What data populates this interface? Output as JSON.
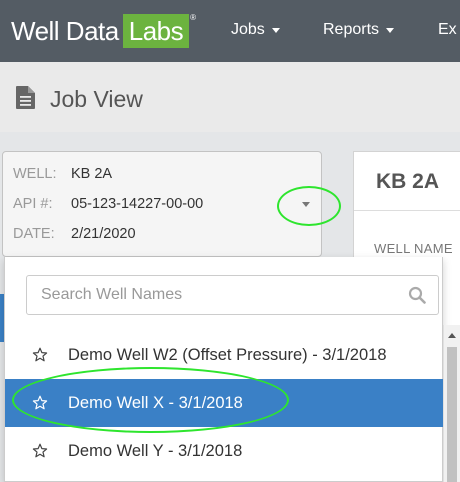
{
  "navbar": {
    "logo_text": "Well Data",
    "logo_box": "Labs",
    "logo_reg": "®",
    "items": [
      {
        "label": "Jobs"
      },
      {
        "label": "Reports"
      },
      {
        "label": "Ex"
      }
    ],
    "background": "#545c64",
    "brand_green": "#6cb33f"
  },
  "page": {
    "title": "Job View",
    "icon": "document-icon"
  },
  "well_info": {
    "well_label": "WELL:",
    "well_value": "KB 2A",
    "api_label": "API #:",
    "api_value": "05-123-14227-00-00",
    "date_label": "DATE:",
    "date_value": "2/21/2020"
  },
  "right_panel": {
    "title": "KB 2A",
    "well_name_label": "WELL NAME"
  },
  "dropdown": {
    "search_placeholder": "Search Well Names",
    "search_value": "",
    "items": [
      {
        "label": "Demo Well W2 (Offset Pressure) - 3/1/2018",
        "selected": false
      },
      {
        "label": "Demo Well X - 3/1/2018",
        "selected": true
      },
      {
        "label": "Demo Well Y - 3/1/2018",
        "selected": false
      }
    ],
    "selected_color": "#3a80c6"
  },
  "highlight_color": "#2ee52e"
}
